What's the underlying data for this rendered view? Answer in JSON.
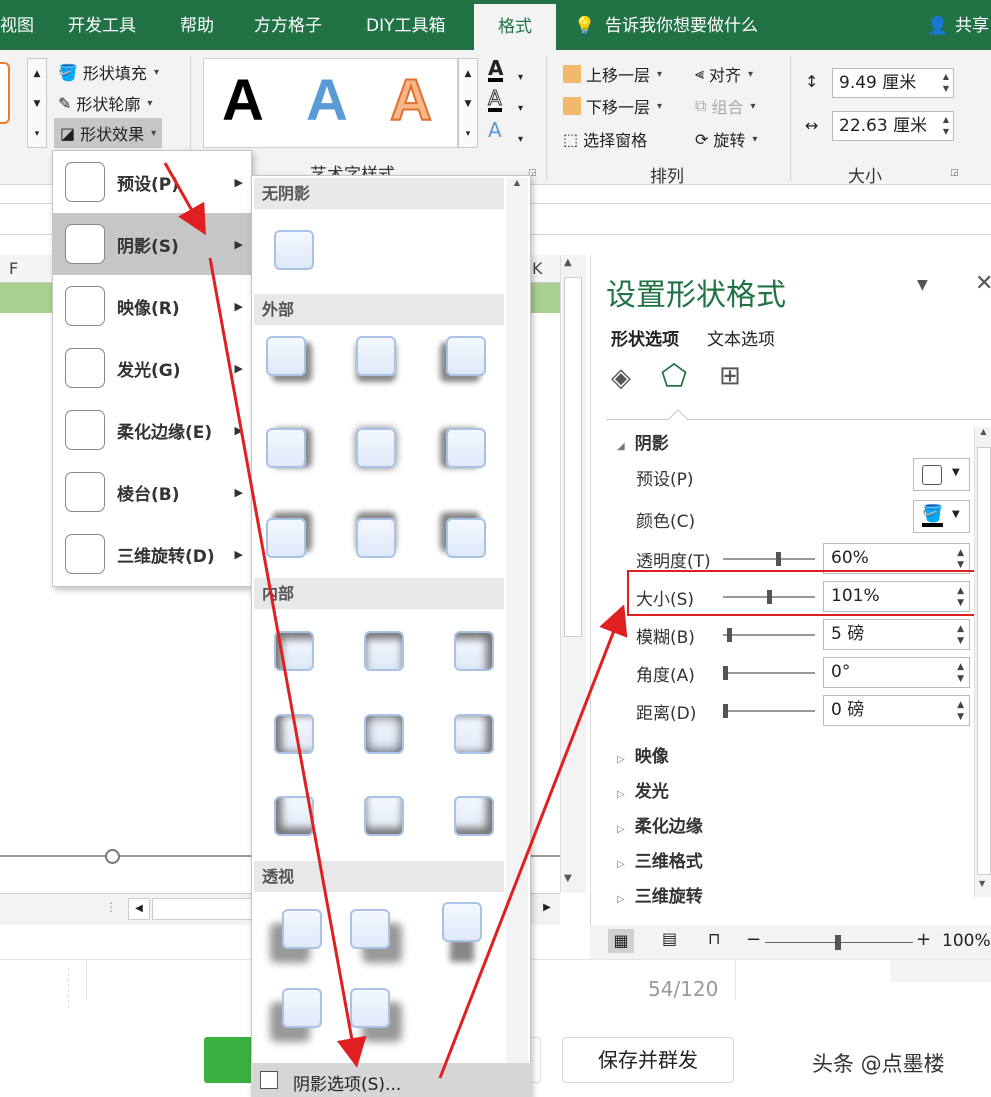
{
  "tabs": [
    "视图",
    "开发工具",
    "帮助",
    "方方格子",
    "DIY工具箱",
    "格式"
  ],
  "tell_me": "告诉我你想要做什么",
  "share": "共享",
  "ribbon": {
    "shape_fill": "形状填充",
    "shape_outline": "形状轮廓",
    "shape_effects": "形状效果",
    "wordart_letter": "A",
    "wordart_group": "艺术字样式",
    "bring_forward": "上移一层",
    "send_backward": "下移一层",
    "selection_pane": "选择窗格",
    "align": "对齐",
    "group": "组合",
    "rotate": "旋转",
    "arrange_group": "排列",
    "height": "9.49 厘米",
    "width": "22.63 厘米",
    "size_group": "大小"
  },
  "sheet": {
    "col_f": "F",
    "col_k": "K"
  },
  "fx_menu": [
    {
      "label": "预设(P)"
    },
    {
      "label": "阴影(S)"
    },
    {
      "label": "映像(R)"
    },
    {
      "label": "发光(G)"
    },
    {
      "label": "柔化边缘(E)"
    },
    {
      "label": "棱台(B)"
    },
    {
      "label": "三维旋转(D)"
    }
  ],
  "gallery": {
    "no_shadow": "无阴影",
    "outer": "外部",
    "inner": "内部",
    "perspective": "透视",
    "options": "阴影选项(S)..."
  },
  "pane": {
    "title": "设置形状格式",
    "tab_shape": "形状选项",
    "tab_text": "文本选项",
    "section": "阴影",
    "preset_label": "预设(P)",
    "color_label": "颜色(C)",
    "rows": [
      {
        "label": "透明度(T)",
        "value": "60%",
        "level": 0.6
      },
      {
        "label": "大小(S)",
        "value": "101%",
        "level": 0.5
      },
      {
        "label": "模糊(B)",
        "value": "5 磅",
        "level": 0.05
      },
      {
        "label": "角度(A)",
        "value": "0°",
        "level": 0
      },
      {
        "label": "距离(D)",
        "value": "0 磅",
        "level": 0
      }
    ],
    "subsections": [
      "映像",
      "发光",
      "柔化边缘",
      "三维格式",
      "三维旋转"
    ]
  },
  "status": {
    "zoom": "100%"
  },
  "bottom": {
    "page_count": "54/120",
    "save_button": "保存并群发",
    "watermark": "头条 @点墨楼"
  },
  "colors": {
    "excel_green": "#217346",
    "highlight_red": "#e02020",
    "row_green": "#a9d08e"
  }
}
